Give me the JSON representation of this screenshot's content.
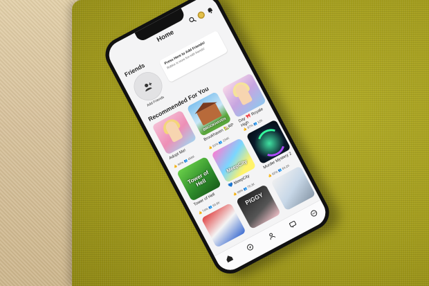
{
  "header": {
    "title": "Home"
  },
  "friends": {
    "section_title": "Friends",
    "add_label": "Add Friends",
    "tip_title": "Press Here to Add Friends!",
    "tip_sub": "Roblox is more fun with friends!"
  },
  "recommended": {
    "section_title": "Recommended For You",
    "games": [
      {
        "name": "Adopt Me!",
        "like": "84%",
        "players": "458K",
        "art": "t-adopt"
      },
      {
        "name": "Brookhaven 🏡RP",
        "like": "91%",
        "players": "234K",
        "art": "t-brook"
      },
      {
        "name": "Day 🎀 Royale High",
        "like": "87%",
        "players": "12K",
        "art": "t-royale"
      },
      {
        "name": "Tower of Hell",
        "like": "74%",
        "players": "93.6K",
        "art": "t-tower"
      },
      {
        "name": "💙 MeepCity",
        "like": "88%",
        "players": "78.3K",
        "art": "t-meep"
      },
      {
        "name": "Murder Mystery 2",
        "like": "92%",
        "players": "64.2K",
        "art": "t-murder"
      },
      {
        "name": "",
        "like": "",
        "players": "",
        "art": "t-r1"
      },
      {
        "name": "",
        "like": "",
        "players": "",
        "art": "t-piggy"
      },
      {
        "name": "",
        "like": "",
        "players": "",
        "art": "t-obby"
      }
    ],
    "art_text": {
      "brook": "BROOKHAVEN",
      "tower": "Tower of Hell",
      "meep": "MeepCity",
      "piggy": "PIGGY"
    }
  },
  "icons": [
    "search-icon",
    "robux-icon",
    "bell-icon",
    "friend-add-icon",
    "home-icon",
    "discover-icon",
    "avatar-icon",
    "chat-icon",
    "more-icon"
  ],
  "colors": {
    "screen_bg": "#f4f4f5",
    "phone_body": "#111111",
    "cushion": "#a49d1d"
  }
}
